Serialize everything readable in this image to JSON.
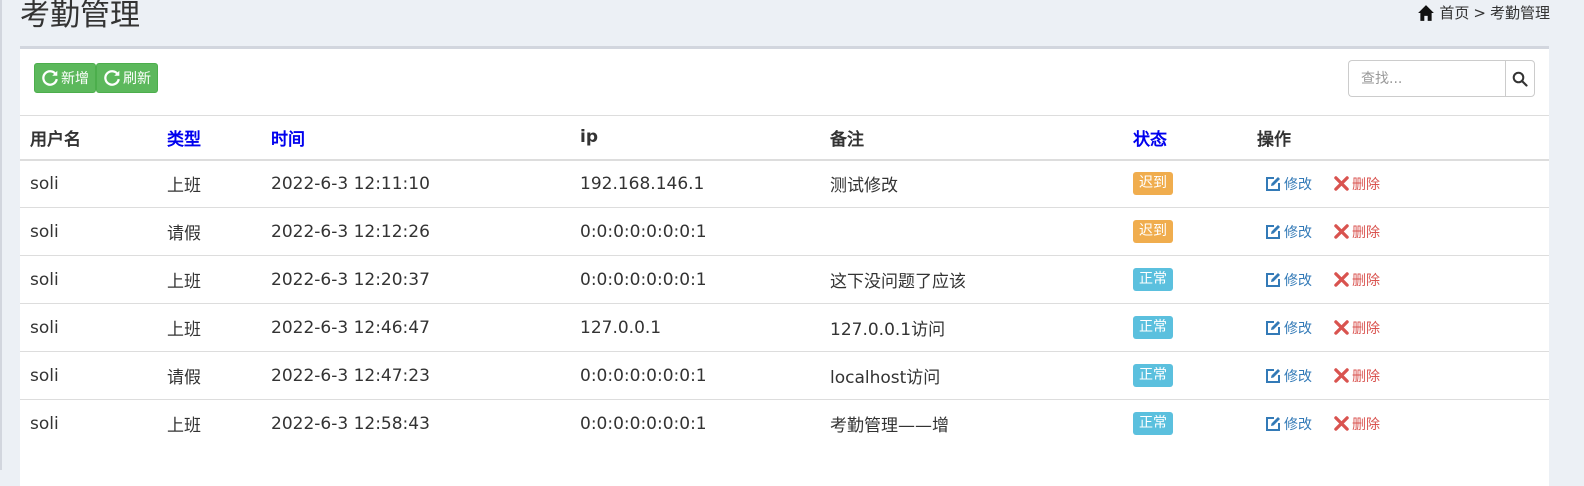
{
  "page": {
    "title": "考勤管理",
    "breadcrumb": {
      "home": "首页",
      "separator": ">",
      "current": "考勤管理"
    }
  },
  "toolbar": {
    "add_label": "新增",
    "refresh_label": "刷新"
  },
  "search": {
    "placeholder": "查找..."
  },
  "table": {
    "columns": [
      "用户名",
      "类型",
      "时间",
      "ip",
      "备注",
      "状态",
      "操作"
    ],
    "rows": [
      {
        "user": "soli",
        "type": "上班",
        "time": "2022-6-3 12:11:10",
        "ip": "192.168.146.1",
        "note": "测试修改",
        "status": "迟到",
        "status_kind": "late"
      },
      {
        "user": "soli",
        "type": "请假",
        "time": "2022-6-3 12:12:26",
        "ip": "0:0:0:0:0:0:0:1",
        "note": "",
        "status": "迟到",
        "status_kind": "late"
      },
      {
        "user": "soli",
        "type": "上班",
        "time": "2022-6-3 12:20:37",
        "ip": "0:0:0:0:0:0:0:1",
        "note": "这下没问题了应该",
        "status": "正常",
        "status_kind": "ok"
      },
      {
        "user": "soli",
        "type": "上班",
        "time": "2022-6-3 12:46:47",
        "ip": "127.0.0.1",
        "note": "127.0.0.1访问",
        "status": "正常",
        "status_kind": "ok"
      },
      {
        "user": "soli",
        "type": "请假",
        "time": "2022-6-3 12:47:23",
        "ip": "0:0:0:0:0:0:0:1",
        "note": "localhost访问",
        "status": "正常",
        "status_kind": "ok"
      },
      {
        "user": "soli",
        "type": "上班",
        "time": "2022-6-3 12:58:43",
        "ip": "0:0:0:0:0:0:0:1",
        "note": "考勤管理——增",
        "status": "正常",
        "status_kind": "ok"
      }
    ],
    "edit_label": "修改",
    "delete_label": "删除"
  },
  "colors": {
    "late": "#f0ad4e",
    "ok": "#5bc0de",
    "success": "#5cb85c",
    "link": "#337ab7",
    "danger": "#d9534f",
    "sortable_header": "#0000ee"
  },
  "icons": {
    "breadcrumb": "home-icon",
    "toolbar": "refresh-icon",
    "search": "search-icon",
    "edit": "edit-icon",
    "delete": "close-icon"
  }
}
